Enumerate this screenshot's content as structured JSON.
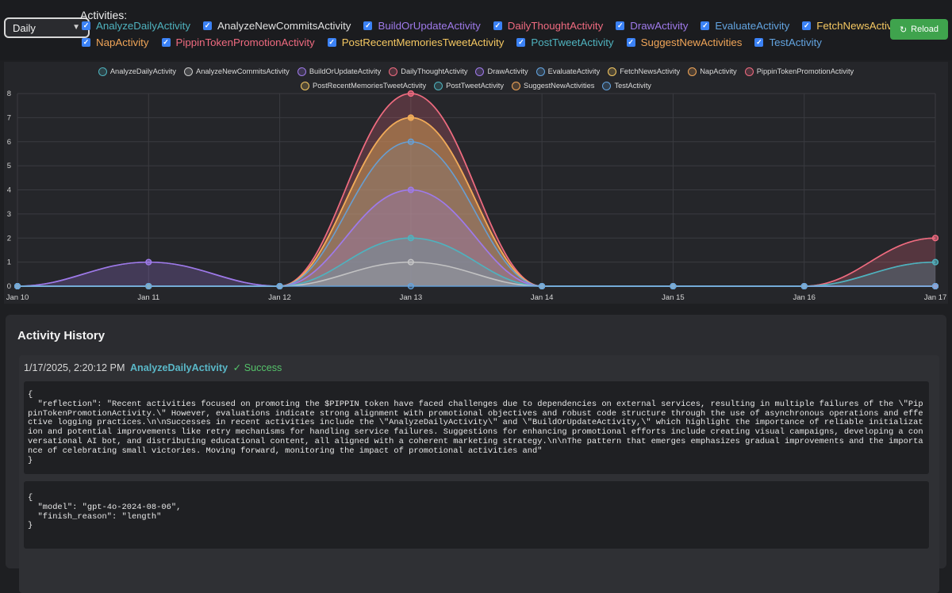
{
  "controls": {
    "period": "Daily",
    "activities_label": "Activities:",
    "reload_label": "Reload",
    "activities": [
      {
        "label": "AnalyzeDailyActivity",
        "color": "#4fb3bf",
        "row": 1,
        "checked": true
      },
      {
        "label": "AnalyzeNewCommitsActivity",
        "color": "#e0e0e0",
        "row": 1,
        "checked": true
      },
      {
        "label": "BuildOrUpdateActivity",
        "color": "#9f7aea",
        "row": 1,
        "checked": true
      },
      {
        "label": "DailyThoughtActivity",
        "color": "#f06b80",
        "row": 1,
        "checked": true
      },
      {
        "label": "DrawActivity",
        "color": "#9f7aea",
        "row": 1,
        "checked": true
      },
      {
        "label": "EvaluateActivity",
        "color": "#63a4e0",
        "row": 1,
        "checked": true
      },
      {
        "label": "FetchNewsActivity",
        "color": "#f5c862",
        "row": 1,
        "checked": true
      },
      {
        "label": "NapActivity",
        "color": "#f0a558",
        "row": 2,
        "checked": true
      },
      {
        "label": "PippinTokenPromotionActivity",
        "color": "#f06b80",
        "row": 2,
        "checked": true
      },
      {
        "label": "PostRecentMemoriesTweetActivity",
        "color": "#f5c862",
        "row": 2,
        "checked": true
      },
      {
        "label": "PostTweetActivity",
        "color": "#4fb3bf",
        "row": 2,
        "checked": true
      },
      {
        "label": "SuggestNewActivities",
        "color": "#f0a558",
        "row": 2,
        "checked": true
      },
      {
        "label": "TestActivity",
        "color": "#63a4e0",
        "row": 2,
        "checked": true
      }
    ]
  },
  "chart_data": {
    "type": "area",
    "x": [
      "Jan 10",
      "Jan 11",
      "Jan 12",
      "Jan 13",
      "Jan 14",
      "Jan 15",
      "Jan 16",
      "Jan 17"
    ],
    "ylim": [
      0,
      8
    ],
    "yticks": [
      0,
      1,
      2,
      3,
      4,
      5,
      6,
      7,
      8
    ],
    "grid": true,
    "legend_position": "top",
    "series": [
      {
        "name": "AnalyzeDailyActivity",
        "color": "#4fb3bf",
        "values": [
          0,
          0,
          0,
          2,
          0,
          0,
          0,
          1
        ]
      },
      {
        "name": "AnalyzeNewCommitsActivity",
        "color": "#c9c9c9",
        "values": [
          0,
          0,
          0,
          1,
          0,
          0,
          0,
          0
        ]
      },
      {
        "name": "BuildOrUpdateActivity",
        "color": "#9f7aea",
        "values": [
          0,
          1,
          0,
          4,
          0,
          0,
          0,
          0
        ]
      },
      {
        "name": "DailyThoughtActivity",
        "color": "#f06b80",
        "values": [
          0,
          0,
          0,
          8,
          0,
          0,
          0,
          2
        ]
      },
      {
        "name": "DrawActivity",
        "color": "#9f7aea",
        "values": [
          0,
          1,
          0,
          4,
          0,
          0,
          0,
          0
        ]
      },
      {
        "name": "EvaluateActivity",
        "color": "#63a4e0",
        "values": [
          0,
          0,
          0,
          6,
          0,
          0,
          0,
          0
        ]
      },
      {
        "name": "FetchNewsActivity",
        "color": "#f5c862",
        "values": [
          0,
          0,
          0,
          7,
          0,
          0,
          0,
          0
        ]
      },
      {
        "name": "NapActivity",
        "color": "#f0a558",
        "values": [
          0,
          0,
          0,
          7,
          0,
          0,
          0,
          0
        ]
      },
      {
        "name": "PippinTokenPromotionActivity",
        "color": "#f06b80",
        "values": [
          0,
          0,
          0,
          8,
          0,
          0,
          0,
          2
        ]
      },
      {
        "name": "PostRecentMemoriesTweetActivity",
        "color": "#f5c862",
        "values": [
          0,
          0,
          0,
          7,
          0,
          0,
          0,
          0
        ]
      },
      {
        "name": "PostTweetActivity",
        "color": "#4fb3bf",
        "values": [
          0,
          0,
          0,
          2,
          0,
          0,
          0,
          1
        ]
      },
      {
        "name": "SuggestNewActivities",
        "color": "#f0a558",
        "values": [
          0,
          0,
          0,
          7,
          0,
          0,
          0,
          0
        ]
      },
      {
        "name": "TestActivity",
        "color": "#63a4e0",
        "values": [
          0,
          0,
          0,
          0,
          0,
          0,
          0,
          0
        ]
      }
    ]
  },
  "history": {
    "title": "Activity History",
    "entry": {
      "timestamp": "1/17/2025, 2:20:12 PM",
      "name": "AnalyzeDailyActivity",
      "status": "✓ Success",
      "data_text": "{\n  \"reflection\": \"Recent activities focused on promoting the $PIPPIN token have faced challenges due to dependencies on external services, resulting in multiple failures of the \\\"PippinTokenPromotionActivity.\\\" However, evaluations indicate strong alignment with promotional objectives and robust code structure through the use of asynchronous operations and effective logging practices.\\n\\nSuccesses in recent activities include the \\\"AnalyzeDailyActivity\\\" and \\\"BuildOrUpdateActivity,\\\" which highlight the importance of reliable initialization and potential improvements like retry mechanisms for handling service failures. Suggestions for enhancing promotional efforts include creating visual campaigns, developing a conversational AI bot, and distributing educational content, all aligned with a coherent marketing strategy.\\n\\nThe pattern that emerges emphasizes gradual improvements and the importance of celebrating small victories. Moving forward, monitoring the impact of promotional activities and\"\n}",
      "meta_text": "{\n  \"model\": \"gpt-4o-2024-08-06\",\n  \"finish_reason\": \"length\"\n}"
    }
  }
}
